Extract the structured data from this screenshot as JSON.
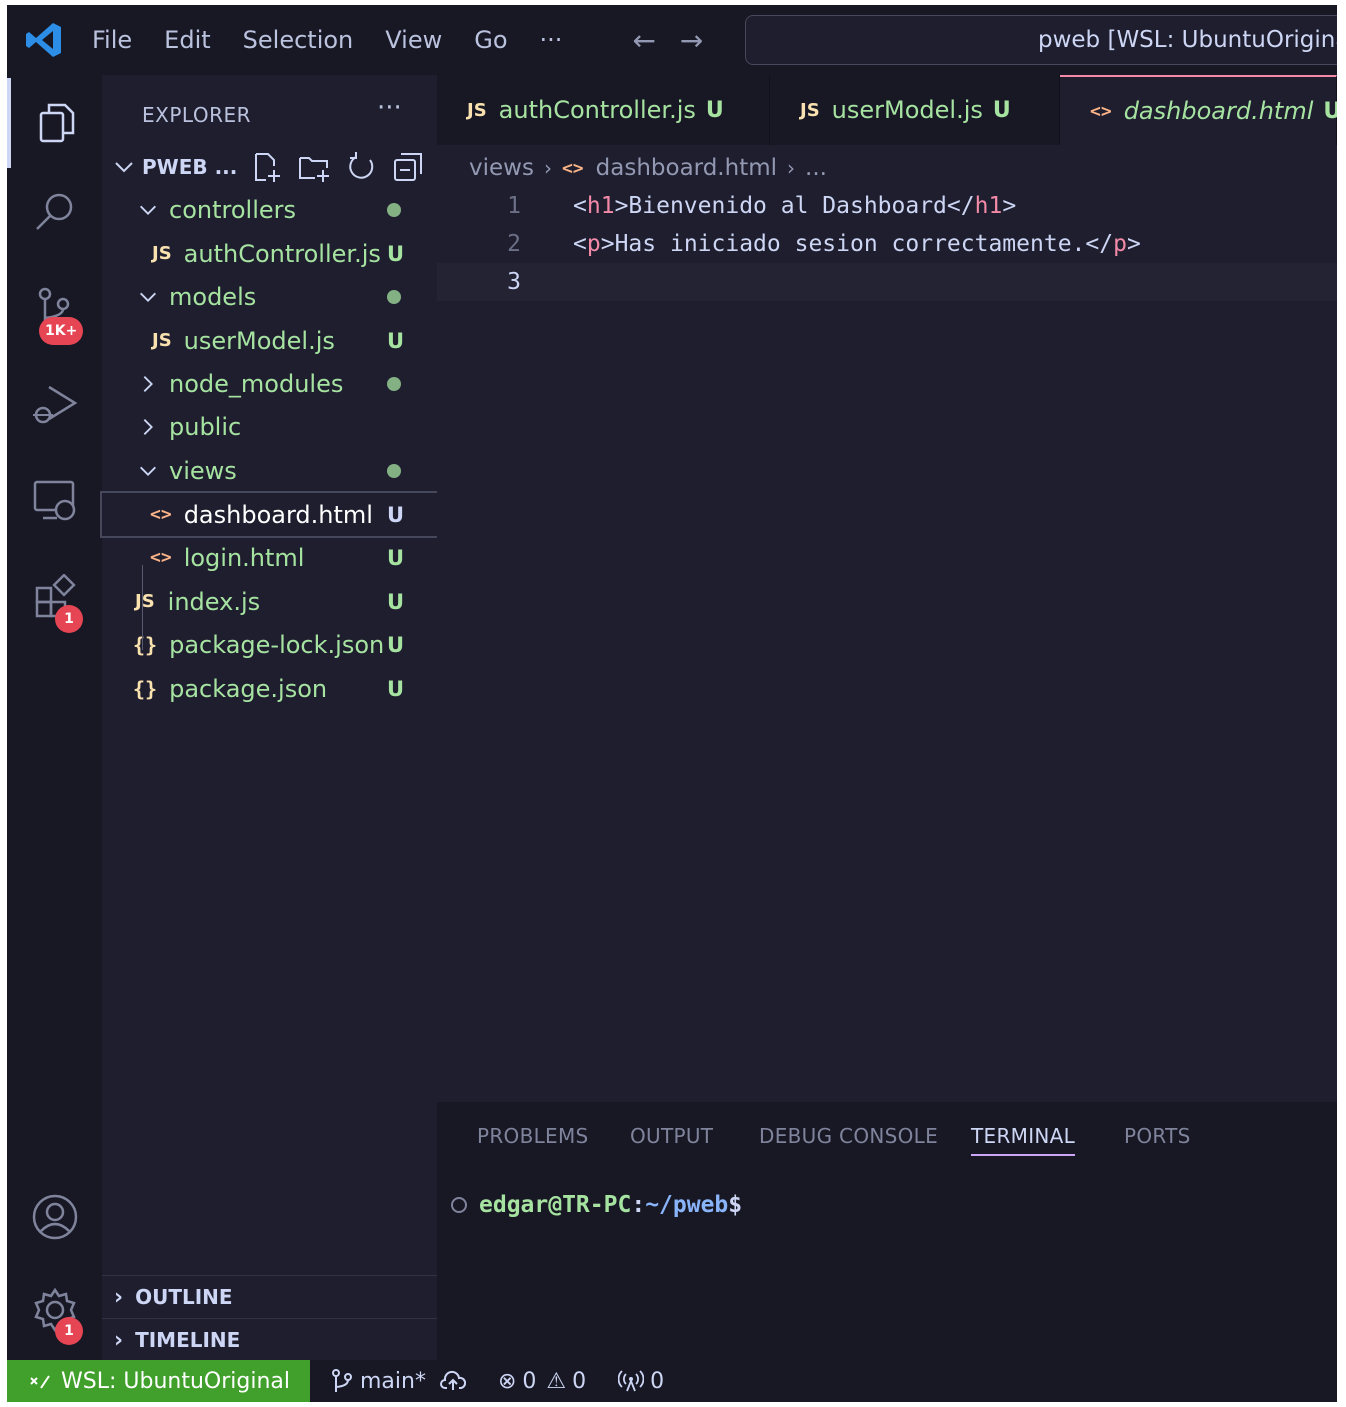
{
  "menu": {
    "file": "File",
    "edit": "Edit",
    "selection": "Selection",
    "view": "View",
    "go": "Go",
    "more": "···"
  },
  "search": {
    "text": "pweb [WSL: UbuntuOriginal]"
  },
  "activity": {
    "scm_badge": "1K+",
    "extensions_badge": "1",
    "settings_badge": "1"
  },
  "explorer": {
    "title": "EXPLORER",
    "more": "···",
    "folder": "PWEB ...",
    "items": [
      {
        "name": "controllers",
        "type": "folder",
        "expanded": true,
        "status": "dot"
      },
      {
        "name": "authController.js",
        "type": "js",
        "status": "U"
      },
      {
        "name": "models",
        "type": "folder",
        "expanded": true,
        "status": "dot"
      },
      {
        "name": "userModel.js",
        "type": "js",
        "status": "U"
      },
      {
        "name": "node_modules",
        "type": "folder",
        "expanded": false,
        "status": "dot"
      },
      {
        "name": "public",
        "type": "folder",
        "expanded": false,
        "status": ""
      },
      {
        "name": "views",
        "type": "folder",
        "expanded": true,
        "status": "dot"
      },
      {
        "name": "dashboard.html",
        "type": "html",
        "status": "U",
        "selected": true
      },
      {
        "name": "login.html",
        "type": "html",
        "status": "U"
      },
      {
        "name": "index.js",
        "type": "js",
        "status": "U"
      },
      {
        "name": "package-lock.json",
        "type": "json",
        "status": "U"
      },
      {
        "name": "package.json",
        "type": "json",
        "status": "U"
      }
    ],
    "outline": "OUTLINE",
    "timeline": "TIMELINE"
  },
  "tabs": [
    {
      "name": "authController.js",
      "status": "U",
      "icon": "JS"
    },
    {
      "name": "userModel.js",
      "status": "U",
      "icon": "JS"
    },
    {
      "name": "dashboard.html",
      "status": "U",
      "icon": "<>",
      "active": true
    }
  ],
  "breadcrumb": {
    "folder": "views",
    "file": "dashboard.html",
    "rest": "..."
  },
  "code": {
    "lines": [
      {
        "num": "1",
        "open": "h1",
        "text": "Bienvenido al Dashboard",
        "close": "h1"
      },
      {
        "num": "2",
        "open": "p",
        "text": "Has iniciado sesion correctamente.",
        "close": "p"
      },
      {
        "num": "3",
        "open": "",
        "text": "",
        "close": ""
      }
    ]
  },
  "panel": {
    "tabs": [
      "PROBLEMS",
      "OUTPUT",
      "DEBUG CONSOLE",
      "TERMINAL",
      "PORTS"
    ],
    "active_tab": "TERMINAL",
    "prompt_user": "edgar@TR-PC",
    "prompt_colon": ":",
    "prompt_path": "~/pweb",
    "prompt_dollar": "$"
  },
  "statusbar": {
    "remote": "WSL: UbuntuOriginal",
    "branch": "main*",
    "errors": "0",
    "warnings": "0",
    "ports": "0"
  },
  "colors": {
    "background": "#1e1e2e",
    "sidebar": "#181825",
    "accent_green": "#a6e3a1",
    "tag_pink": "#f38ba8",
    "remote_green": "#40a02b"
  }
}
